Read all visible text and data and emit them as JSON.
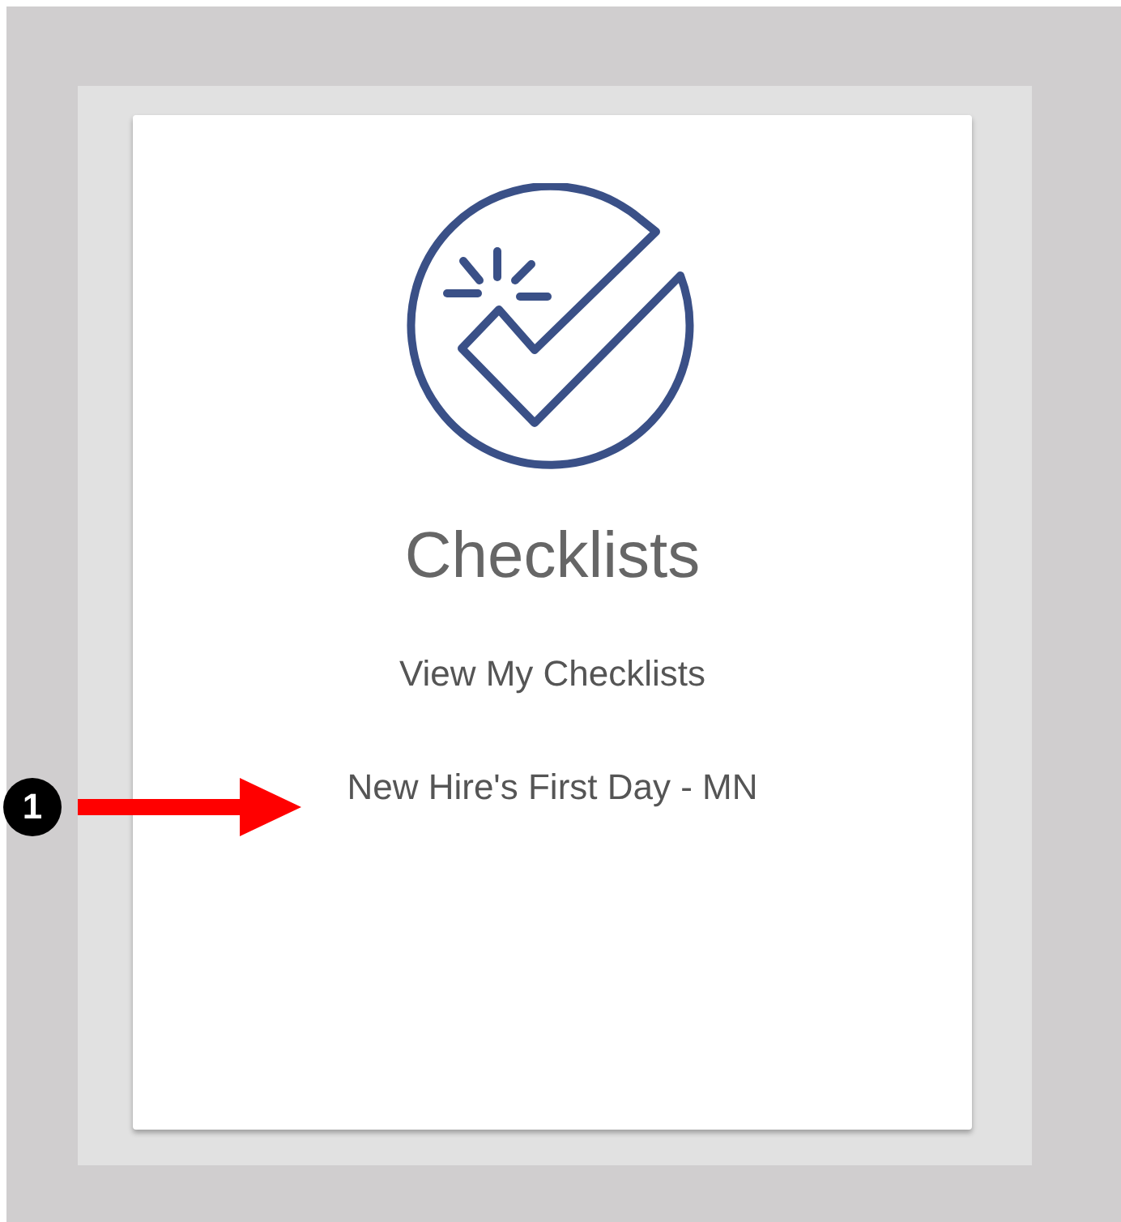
{
  "card": {
    "title": "Checklists",
    "links": [
      {
        "label": "View My Checklists"
      },
      {
        "label": "New Hire's First Day - MN"
      }
    ]
  },
  "callout": {
    "number": "1"
  }
}
